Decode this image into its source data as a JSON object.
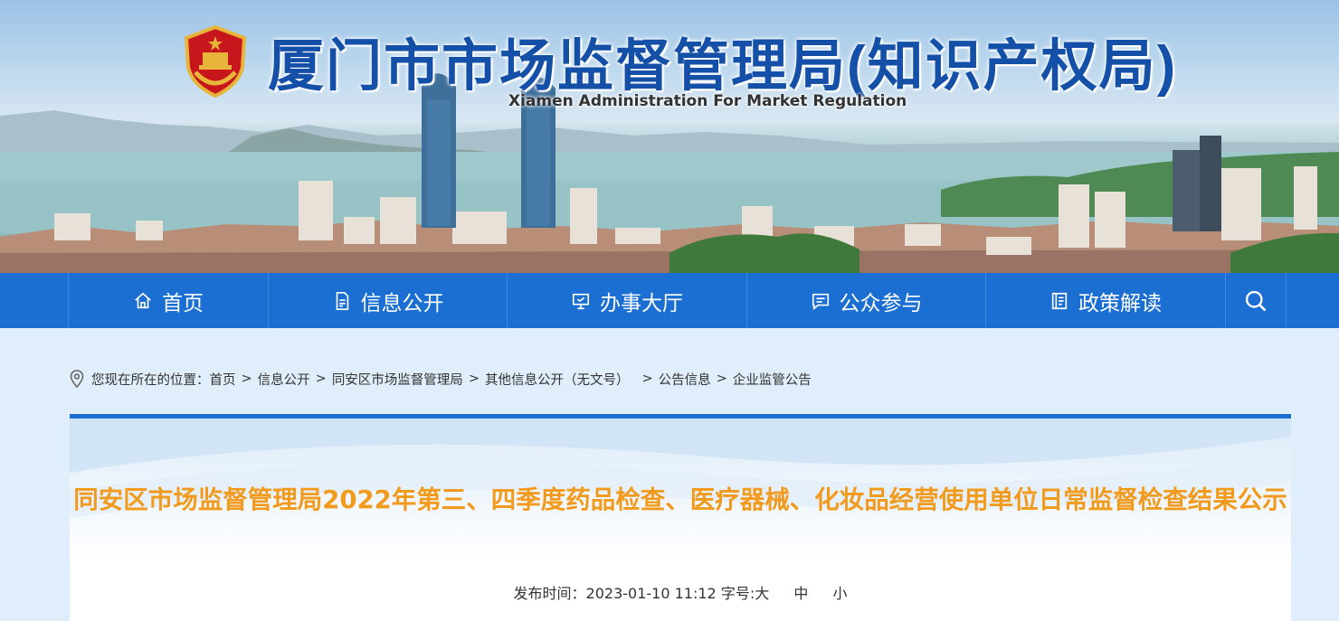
{
  "header": {
    "title": "厦门市市场监督管理局(知识产权局)",
    "subtitle": "Xiamen Administration For Market Regulation",
    "emblem_icon": "national-emblem-icon"
  },
  "nav": {
    "items": [
      {
        "label": "首页",
        "icon": "home-icon"
      },
      {
        "label": "信息公开",
        "icon": "document-icon"
      },
      {
        "label": "办事大厅",
        "icon": "monitor-icon"
      },
      {
        "label": "公众参与",
        "icon": "chat-icon"
      },
      {
        "label": "政策解读",
        "icon": "book-icon"
      }
    ],
    "search_icon": "search-icon",
    "color": "#1b6fd3"
  },
  "breadcrumb": {
    "prefix": "您现在所在的位置：",
    "items": [
      "首页",
      "信息公开",
      "同安区市场监督管理局",
      "其他信息公开（无文号）",
      "公告信息",
      "企业监管公告"
    ],
    "separator": ">"
  },
  "article": {
    "title": "同安区市场监督管理局2022年第三、四季度药品检查、医疗器械、化妆品经营使用单位日常监督检查结果公示",
    "publish_label": "发布时间：",
    "publish_time": "2023-01-10 11:12",
    "font_size_label": "字号:",
    "sizes": [
      "大",
      "中",
      "小"
    ],
    "title_color": "#f29a1b"
  }
}
